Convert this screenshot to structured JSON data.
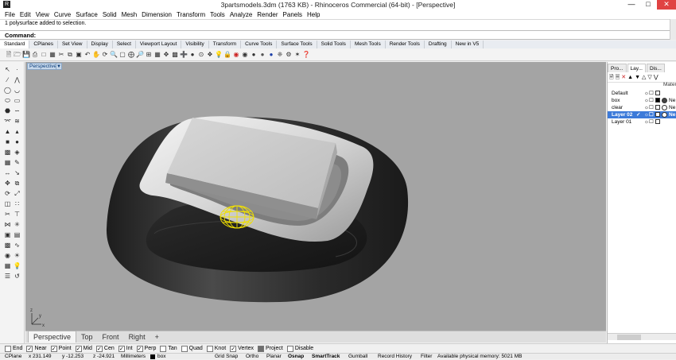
{
  "window": {
    "title": "3partsmodels.3dm (1763 KB) - Rhinoceros Commercial (64-bit) - [Perspective]",
    "app_icon": "rhino-icon",
    "controls": [
      "minimize",
      "maximize",
      "close"
    ]
  },
  "menu": [
    "File",
    "Edit",
    "View",
    "Curve",
    "Surface",
    "Solid",
    "Mesh",
    "Dimension",
    "Transform",
    "Tools",
    "Analyze",
    "Render",
    "Panels",
    "Help"
  ],
  "command": {
    "history": "1 polysurface added to selection.",
    "prompt": "Command:"
  },
  "toolbar_tabs": [
    {
      "label": "Standard",
      "active": true
    },
    {
      "label": "CPlanes",
      "active": false
    },
    {
      "label": "Set View",
      "active": false
    },
    {
      "label": "Display",
      "active": false
    },
    {
      "label": "Select",
      "active": false
    },
    {
      "label": "Viewport Layout",
      "active": false
    },
    {
      "label": "Visibility",
      "active": false
    },
    {
      "label": "Transform",
      "active": false
    },
    {
      "label": "Curve Tools",
      "active": false
    },
    {
      "label": "Surface Tools",
      "active": false
    },
    {
      "label": "Solid Tools",
      "active": false
    },
    {
      "label": "Mesh Tools",
      "active": false
    },
    {
      "label": "Render Tools",
      "active": false
    },
    {
      "label": "Drafting",
      "active": false
    },
    {
      "label": "New in V5",
      "active": false
    }
  ],
  "viewport": {
    "label": "Perspective",
    "dropdown_icon": "triangle-down-icon",
    "axis_labels": {
      "z": "z",
      "y": "y",
      "x": "x"
    }
  },
  "viewport_tabs": [
    {
      "label": "Perspective",
      "active": true
    },
    {
      "label": "Top",
      "active": false
    },
    {
      "label": "Front",
      "active": false
    },
    {
      "label": "Right",
      "active": false
    },
    {
      "label": "+",
      "active": false
    }
  ],
  "panel": {
    "tabs": [
      {
        "label": "Pro...",
        "active": false
      },
      {
        "label": "Lay...",
        "active": true
      },
      {
        "label": "Dis...",
        "active": false
      }
    ],
    "material_header": "Materi",
    "layers": [
      {
        "name": "Default",
        "selected": false,
        "current": false,
        "color": "#ffffff",
        "material": ""
      },
      {
        "name": "box",
        "selected": false,
        "current": false,
        "color": "#000000",
        "material": "Ne"
      },
      {
        "name": "clear",
        "selected": false,
        "current": false,
        "color": "#ffffff",
        "material": "Ne"
      },
      {
        "name": "Layer 02",
        "selected": true,
        "current": true,
        "color": "#ffffff",
        "material": "Ne"
      },
      {
        "name": "Layer 01",
        "selected": false,
        "current": false,
        "color": "#ffffff",
        "material": ""
      }
    ]
  },
  "osnaps": [
    {
      "label": "End",
      "checked": false
    },
    {
      "label": "Near",
      "checked": true
    },
    {
      "label": "Point",
      "checked": true
    },
    {
      "label": "Mid",
      "checked": true
    },
    {
      "label": "Cen",
      "checked": true
    },
    {
      "label": "Int",
      "checked": true
    },
    {
      "label": "Perp",
      "checked": true
    },
    {
      "label": "Tan",
      "checked": false
    },
    {
      "label": "Quad",
      "checked": false
    },
    {
      "label": "Knot",
      "checked": false
    },
    {
      "label": "Vertex",
      "checked": true
    },
    {
      "label": "Project",
      "checked": false,
      "partial": true
    },
    {
      "label": "Disable",
      "checked": false
    }
  ],
  "status": {
    "cplane": "CPlane",
    "x": "x 231.149",
    "y": "y -12.253",
    "z": "z -24.921",
    "units": "Millimeters",
    "layer": "box",
    "toggles": [
      "Grid Snap",
      "Ortho",
      "Planar",
      "Osnap",
      "SmartTrack",
      "Gumball",
      "Record History",
      "Filter"
    ],
    "memory": "Available physical memory: 5021 MB"
  },
  "colors": {
    "viewport_bg": "#a4a4a4",
    "selection": "#f0e000",
    "layer_selected": "#3c7ad9",
    "close_button": "#e04343"
  }
}
